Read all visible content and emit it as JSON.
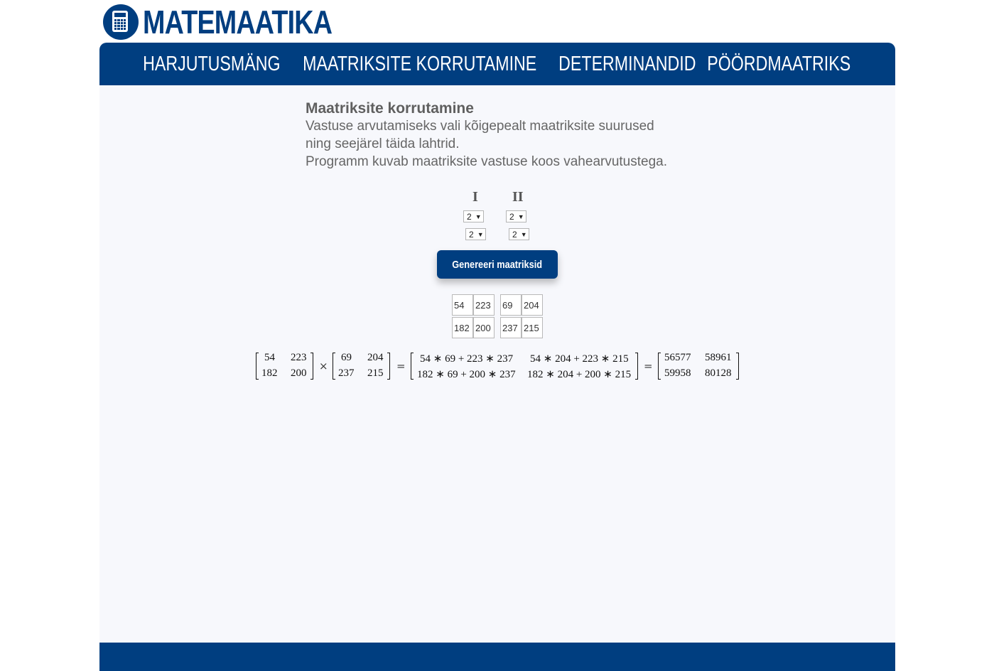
{
  "logo": {
    "text": "MATEMAATIKA",
    "icon": "calculator-icon"
  },
  "nav": [
    "HARJUTUSMÄNG",
    "MAATRIKSITE KORRUTAMINE",
    "DETERMINANDID",
    "PÖÖRDMAATRIKS"
  ],
  "intro": {
    "heading": "Maatriksite korrutamine",
    "line1": "Vastuse arvutamiseks vali kõigepealt maatriksite suurused",
    "line2": "ning seejärel täida lahtrid.",
    "line3": "Programm kuvab maatriksite vastuse koos vahearvutustega."
  },
  "matrix_labels": {
    "first": "I",
    "second": "II"
  },
  "selects": {
    "m1_rows": "2",
    "m1_cols": "2",
    "m2_rows": "2",
    "m2_cols": "2"
  },
  "button_label": "Genereeri maatriksid",
  "inputs": {
    "m1": [
      [
        "54",
        "223"
      ],
      [
        "182",
        "200"
      ]
    ],
    "m2": [
      [
        "69",
        "204"
      ],
      [
        "237",
        "215"
      ]
    ]
  },
  "result": {
    "operator_times": "×",
    "operator_eq": "=",
    "expr": [
      [
        "54 ∗ 69 + 223 ∗ 237",
        "54 ∗ 204 + 223 ∗ 215"
      ],
      [
        "182 ∗ 69 + 200 ∗ 237",
        "182 ∗ 204 + 200 ∗ 215"
      ]
    ],
    "values": [
      [
        "56577",
        "58961"
      ],
      [
        "59958",
        "80128"
      ]
    ]
  },
  "colors": {
    "brand": "#003e80",
    "background": "#f7f8fc",
    "text": "#666666"
  }
}
